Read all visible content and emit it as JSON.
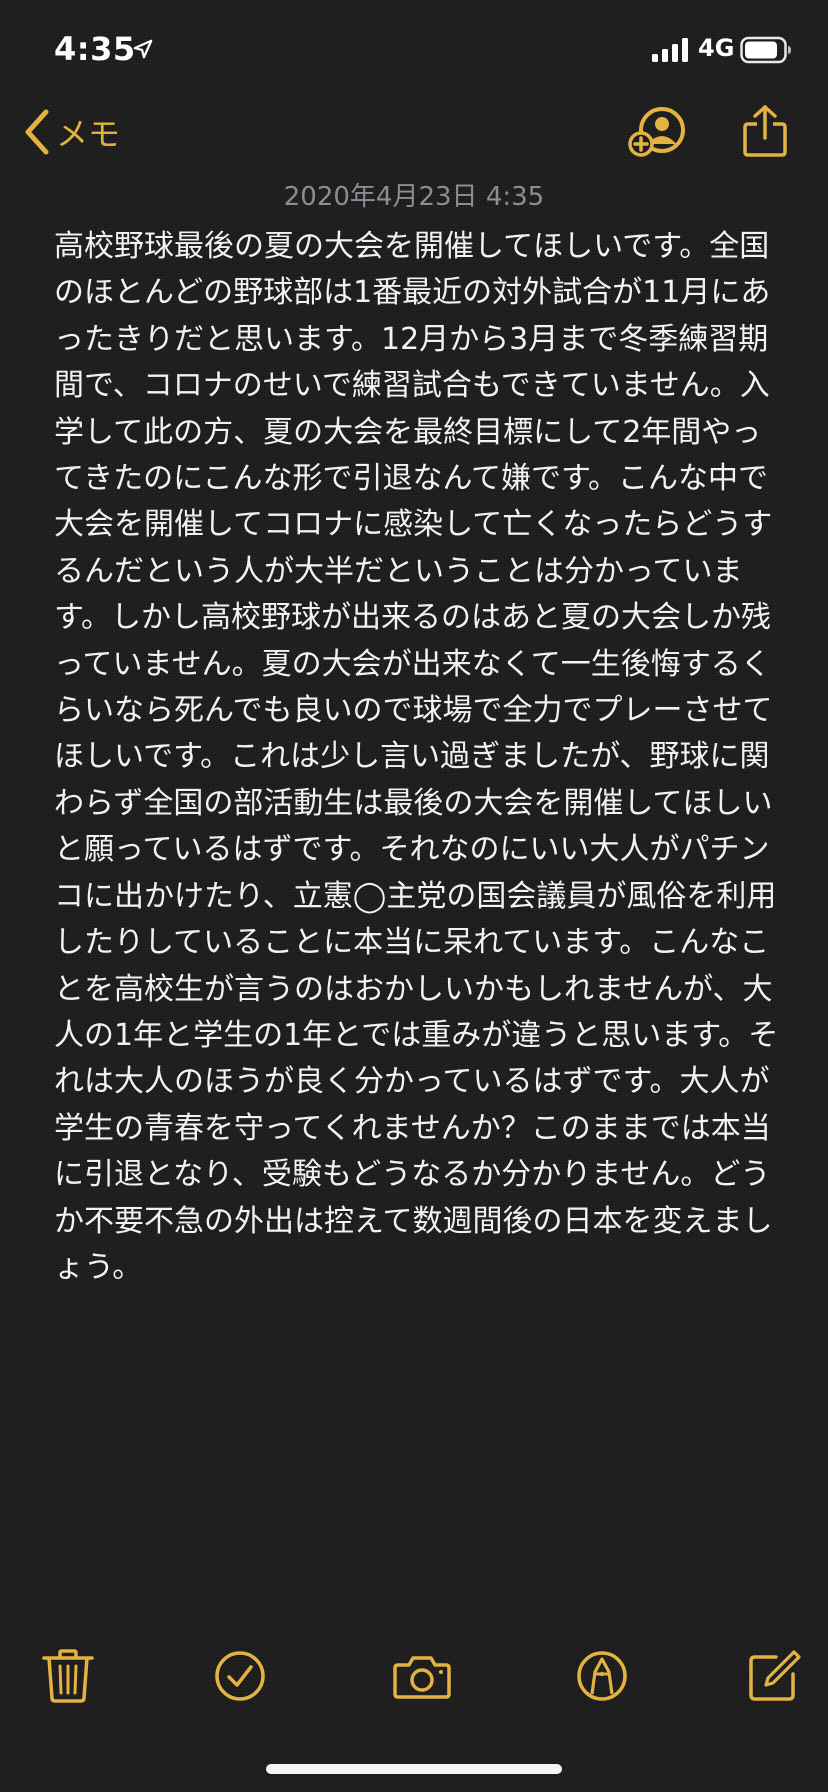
{
  "status_bar": {
    "time": "4:35",
    "network": "4G"
  },
  "nav": {
    "back_label": "メモ"
  },
  "note": {
    "date": "2020年4月23日 4:35",
    "body": "高校野球最後の夏の大会を開催してほしいです。全国のほとんどの野球部は1番最近の対外試合が11月にあったきりだと思います。12月から3月まで冬季練習期間で、コロナのせいで練習試合もできていません。入学して此の方、夏の大会を最終目標にして2年間やってきたのにこんな形で引退なんて嫌です。こんな中で大会を開催してコロナに感染して亡くなったらどうするんだという人が大半だということは分かっています。しかし高校野球が出来るのはあと夏の大会しか残っていません。夏の大会が出来なくて一生後悔するくらいなら死んでも良いので球場で全力でプレーさせてほしいです。これは少し言い過ぎましたが、野球に関わらず全国の部活動生は最後の大会を開催してほしいと願っているはずです。それなのにいい大人がパチンコに出かけたり、立憲◯主党の国会議員が風俗を利用したりしていることに本当に呆れています。こんなことを高校生が言うのはおかしいかもしれませんが、大人の1年と学生の1年とでは重みが違うと思います。それは大人のほうが良く分かっているはずです。大人が学生の青春を守ってくれませんか？このままでは本当に引退となり、受験もどうなるか分かりません。どうか不要不急の外出は控えて数週間後の日本を変えましょう。"
  },
  "icons": {
    "status": [
      "location-arrow-icon",
      "signal-bars-icon",
      "battery-icon"
    ],
    "nav": [
      "chevron-left-icon",
      "add-person-icon",
      "share-icon"
    ],
    "toolbar": [
      "trash-icon",
      "checklist-icon",
      "camera-icon",
      "markup-pen-icon",
      "compose-icon"
    ]
  },
  "colors": {
    "accent": "#e3b341",
    "background": "#1e1e1e",
    "text": "#f2f2f2",
    "date_text": "#8c8c94"
  }
}
